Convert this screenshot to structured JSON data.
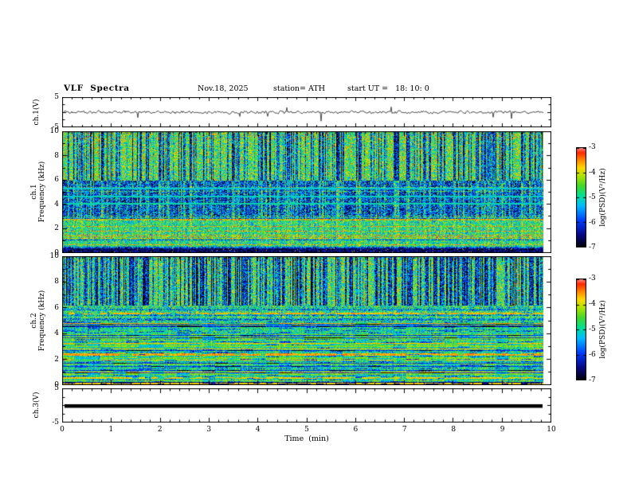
{
  "header": {
    "title": "VLF  Spectra",
    "date": "Nov.18, 2025",
    "station": "station= ATH",
    "start_ut": "start UT =   18: 10: 0"
  },
  "axes": {
    "time_label": "Time  (min)",
    "time_ticks": [
      0,
      1,
      2,
      3,
      4,
      5,
      6,
      7,
      8,
      9,
      10
    ],
    "waveform": {
      "label": "ch.1(V)",
      "yticks": [
        5,
        -5
      ],
      "ylim": [
        -5,
        5
      ]
    },
    "spec1": {
      "channel": "ch.1",
      "axis_label": "Frequency  (kHz)",
      "yticks": [
        10,
        8,
        6,
        4,
        2,
        0
      ],
      "ylim": [
        0,
        10
      ]
    },
    "spec2": {
      "channel": "ch.2",
      "axis_label": "Frequency  (kHz)",
      "yticks": [
        10,
        8,
        6,
        4,
        2,
        0
      ],
      "ylim": [
        0,
        10
      ]
    },
    "ch3": {
      "label": "ch.3(V)",
      "yticks": [
        5,
        -5
      ],
      "ylim": [
        -5,
        5
      ]
    }
  },
  "colorbar": {
    "label": "log(PSD)(V²/Hz)",
    "ticks": [
      -3,
      -4,
      -5,
      -6,
      -7
    ],
    "zlim": [
      -7,
      -3
    ]
  },
  "chart_data": [
    {
      "type": "line",
      "name": "ch1_waveform",
      "ylabel": "ch.1(V)",
      "xlim": [
        0,
        10
      ],
      "ylim": [
        -5,
        5
      ],
      "baseline_V": 0,
      "fluctuation_V": 1,
      "spike_min_V": -3,
      "summary": "Noisy voltage trace centered near 0 V with roughly ±1 V fluctuations and intermittent downward spikes reaching about -3 V"
    },
    {
      "type": "heatmap",
      "name": "ch1_spectrogram",
      "xlabel": "Time (min)",
      "ylabel": "Frequency (kHz)",
      "xlim": [
        0,
        10
      ],
      "ylim": [
        0,
        10
      ],
      "zlabel": "log(PSD)(V²/Hz)",
      "zlim": [
        -7,
        -3
      ],
      "colormap": "rainbow",
      "streak_density": 0.32,
      "top_specks": 0.05,
      "dashed_lines": false,
      "bands": [
        {
          "f": [
            6,
            10
          ],
          "level": -4.5,
          "spread": 1.0,
          "texture": "vertical-dropouts"
        },
        {
          "f": [
            3,
            6
          ],
          "level": -6.0,
          "spread": 1.1,
          "texture": "vertical-enhancements",
          "lines": [
            {
              "f": 4.1,
              "level": -5.0
            },
            {
              "f": 4.7,
              "level": -5.1
            },
            {
              "f": 5.3,
              "level": -5.2
            }
          ]
        },
        {
          "f": [
            0.4,
            3
          ],
          "level": -4.9,
          "spread": 0.9,
          "texture": "horizontal-stripes"
        },
        {
          "f": [
            0,
            0.4
          ],
          "level": -6.6,
          "spread": 0.6,
          "texture": "dark-band"
        }
      ],
      "summary": "Green/yellow broadband power above 6 kHz interrupted by many narrow dark-blue vertical dropouts; low-power blue region 3-6 kHz with thin horizontal lines and vertical green streaks; speckled cyan-green band 0.4-3 kHz with yellow horizontal stripes; dark band below 0.4 kHz"
    },
    {
      "type": "heatmap",
      "name": "ch2_spectrogram",
      "xlabel": "Time (min)",
      "ylabel": "Frequency (kHz)",
      "xlim": [
        0,
        10
      ],
      "ylim": [
        0,
        10
      ],
      "zlabel": "log(PSD)(V²/Hz)",
      "zlim": [
        -7,
        -3
      ],
      "colormap": "rainbow",
      "streak_density": 0.45,
      "top_specks": 0.02,
      "dashed_lines": true,
      "bands": [
        {
          "f": [
            6.2,
            10
          ],
          "level": -4.6,
          "spread": 1.0,
          "texture": "vertical-dropouts"
        },
        {
          "f": [
            5,
            6.2
          ],
          "level": -5.3,
          "spread": 1.0,
          "texture": "mixed",
          "lines": [
            {
              "f": 5.6,
              "level": -3.7
            }
          ]
        },
        {
          "f": [
            0.3,
            5
          ],
          "level": -5.0,
          "spread": 0.8,
          "texture": "horizontal-bands",
          "lines": [
            {
              "f": 2.4,
              "level": -3.6
            },
            {
              "f": 0.6,
              "level": -3.8
            }
          ]
        },
        {
          "f": [
            0,
            0.3
          ],
          "level": -6.5,
          "spread": 0.5,
          "texture": "dark-band",
          "lines": [
            {
              "f": 0.15,
              "level": -3.8
            }
          ]
        }
      ],
      "summary": "Green background above 6 kHz with dense dark-blue vertical dropout streaks; strong horizontal banding below 5 kHz with alternating green/yellow/cyan rows and a few red-orange lines; dark band with a red line near 0 kHz"
    },
    {
      "type": "line",
      "name": "ch3_waveform",
      "ylabel": "ch.3(V)",
      "xlim": [
        0,
        10
      ],
      "ylim": [
        -5,
        5
      ],
      "constant_V": 0,
      "summary": "Constant 0 V flat thick black trace"
    }
  ]
}
